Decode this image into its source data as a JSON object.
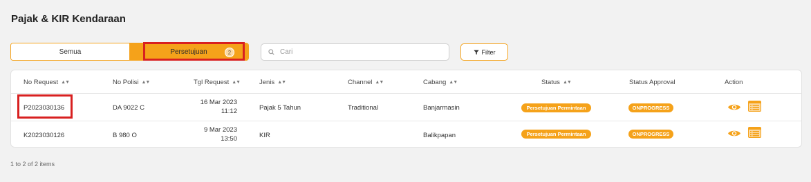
{
  "page": {
    "title": "Pajak & KIR Kendaraan"
  },
  "tabs": {
    "all_label": "Semua",
    "approval_label": "Persetujuan",
    "approval_count": "2"
  },
  "search": {
    "placeholder": "Cari",
    "value": ""
  },
  "filter": {
    "label": "Filter"
  },
  "table": {
    "columns": {
      "no_request": "No Request",
      "no_polisi": "No Polisi",
      "tgl_request": "Tgl Request",
      "jenis": "Jenis",
      "channel": "Channel",
      "cabang": "Cabang",
      "status": "Status",
      "status_approval": "Status Approval",
      "action": "Action"
    },
    "rows": [
      {
        "no_request": "P2023030136",
        "no_polisi": "DA 9022 C",
        "tgl_date": "16 Mar 2023",
        "tgl_time": "11:12",
        "jenis": "Pajak 5 Tahun",
        "channel": "Traditional",
        "cabang": "Banjarmasin",
        "status": "Persetujuan Permintaan",
        "status_approval": "ONPROGRESS"
      },
      {
        "no_request": "K2023030126",
        "no_polisi": "B 980 O",
        "tgl_date": "9 Mar 2023",
        "tgl_time": "13:50",
        "jenis": "KIR",
        "channel": "",
        "cabang": "Balikpapan",
        "status": "Persetujuan Permintaan",
        "status_approval": "ONPROGRESS"
      }
    ]
  },
  "pagination": {
    "summary": "1 to 2 of 2 items"
  },
  "colors": {
    "accent": "#f5a21a",
    "highlight": "#d82020"
  }
}
